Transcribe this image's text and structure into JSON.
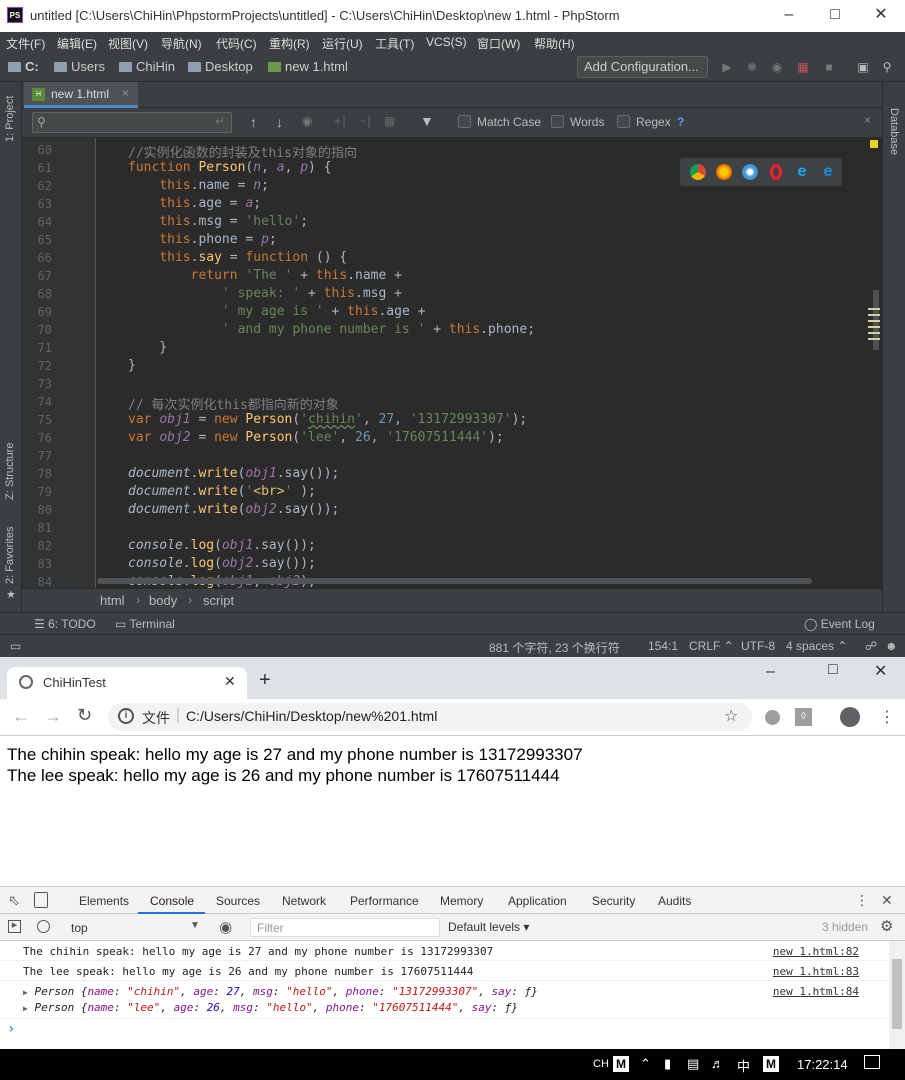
{
  "ide": {
    "title": "untitled [C:\\Users\\ChiHin\\PhpstormProjects\\untitled] - C:\\Users\\ChiHin\\Desktop\\new 1.html - PhpStorm",
    "logo": "PS",
    "menu": [
      "文件(F)",
      "编辑(E)",
      "视图(V)",
      "导航(N)",
      "代码(C)",
      "重构(R)",
      "运行(U)",
      "工具(T)",
      "VCS(S)",
      "窗口(W)",
      "帮助(H)"
    ],
    "breadcrumbs": [
      "C:",
      "Users",
      "ChiHin",
      "Desktop",
      "new 1.html"
    ],
    "add_config": "Add Configuration...",
    "left_panels": [
      "1: Project",
      "Z: Structure",
      "2: Favorites"
    ],
    "right_panels": [
      "Database"
    ],
    "tab": "new 1.html",
    "find": {
      "match_case": "Match Case",
      "words": "Words",
      "regex": "Regex",
      "help": "?"
    },
    "line_numbers": [
      "60",
      "61",
      "62",
      "63",
      "64",
      "65",
      "66",
      "67",
      "68",
      "69",
      "70",
      "71",
      "72",
      "73",
      "74",
      "75",
      "76",
      "77",
      "78",
      "79",
      "80",
      "81",
      "82",
      "83",
      "84"
    ],
    "code_breadcrumb": [
      "html",
      "body",
      "script"
    ],
    "bottom_tools": {
      "todo": "6: TODO",
      "terminal": "Terminal",
      "event_log": "Event Log"
    },
    "status": {
      "chars": "881 个字符, 23 个换行符",
      "pos": "154:1",
      "crlf": "CRLF",
      "enc": "UTF-8",
      "indent": "4 spaces"
    }
  },
  "chrome": {
    "tab_title": "ChiHinTest",
    "url_prefix": "文件",
    "url": "C:/Users/ChiHin/Desktop/new%201.html",
    "page_lines": [
      "The chihin speak: hello my age is 27 and my phone number is 13172993307",
      "The lee speak: hello my age is 26 and my phone number is 17607511444"
    ]
  },
  "devtools": {
    "tabs": [
      "Elements",
      "Console",
      "Sources",
      "Network",
      "Performance",
      "Memory",
      "Application",
      "Security",
      "Audits"
    ],
    "active_tab": "Console",
    "context": "top",
    "filter_placeholder": "Filter",
    "levels": "Default levels ▾",
    "hidden": "3 hidden",
    "logs": [
      {
        "text": "The chihin speak: hello my age is 27 and my phone number is 13172993307",
        "src": "new 1.html:82"
      },
      {
        "text": "The lee speak: hello my age is 26 and my phone number is 17607511444",
        "src": "new 1.html:83"
      }
    ],
    "objects": {
      "src": "new 1.html:84"
    },
    "prompt": "›"
  },
  "taskbar": {
    "ime": "CH",
    "lang": "中",
    "time": "17:22:14",
    "m": "M"
  },
  "colors": {
    "ide_bg": "#3c3f41",
    "editor_bg": "#2b2b2b",
    "keyword": "#cc7832",
    "string": "#6a8759",
    "number": "#6897bb",
    "accent": "#4a88c7"
  }
}
